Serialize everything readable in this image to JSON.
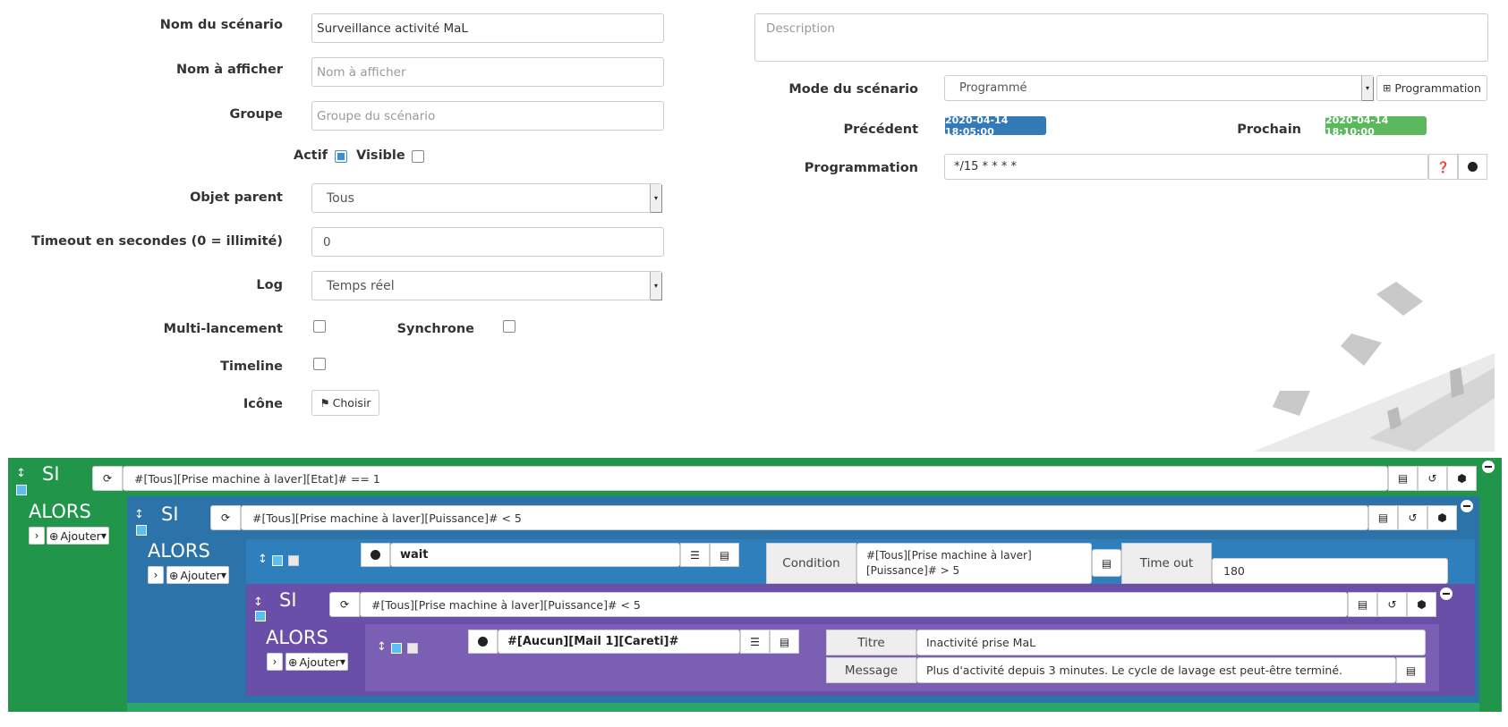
{
  "form": {
    "scenario_name_label": "Nom du scénario",
    "scenario_name_value": "Surveillance activité MaL",
    "display_name_label": "Nom à afficher",
    "display_name_placeholder": "Nom à afficher",
    "group_label": "Groupe",
    "group_placeholder": "Groupe du scénario",
    "actif_label": "Actif",
    "visible_label": "Visible",
    "parent_label": "Objet parent",
    "parent_value": "Tous",
    "timeout_label": "Timeout en secondes (0 = illimité)",
    "timeout_value": "0",
    "log_label": "Log",
    "log_value": "Temps réel",
    "multi_label": "Multi-lancement",
    "sync_label": "Synchrone",
    "timeline_label": "Timeline",
    "icon_label": "Icône",
    "choose_label": "Choisir"
  },
  "right": {
    "description_placeholder": "Description",
    "mode_label": "Mode du scénario",
    "mode_value": "Programmé",
    "programmation_button": "Programmation",
    "previous_label": "Précédent",
    "previous_value": "2020-04-14 18:05:00",
    "next_label": "Prochain",
    "next_value": "2020-04-14 18:10:00",
    "programmation_label": "Programmation",
    "cron_value": "*/15 * * * *"
  },
  "blocks": {
    "si": "SI",
    "alors": "ALORS",
    "add": "Ajouter",
    "cond1": "#[Tous][Prise machine à laver][Etat]# == 1",
    "cond2": "#[Tous][Prise machine à laver][Puissance]# < 5",
    "wait_cmd": "wait",
    "condition_label": "Condition",
    "condition_value": "#[Tous][Prise machine à laver][Puissance]# > 5",
    "timeout_label": "Time out",
    "timeout_value": "180",
    "cond3": "#[Tous][Prise machine à laver][Puissance]# < 5",
    "mail_cmd": "#[Aucun][Mail 1][Careti]#",
    "title_label": "Titre",
    "title_value": "Inactivité prise MaL",
    "message_label": "Message",
    "message_value": "Plus d'activité depuis 3 minutes. Le cycle de lavage est peut-être terminé."
  },
  "colors": {
    "green": "#21964b",
    "blue": "#2b73a9",
    "purple": "#6a4fa8",
    "purple_light": "#7a5fb5",
    "badge_blue": "#337ab7",
    "badge_green": "#5cb85c"
  }
}
